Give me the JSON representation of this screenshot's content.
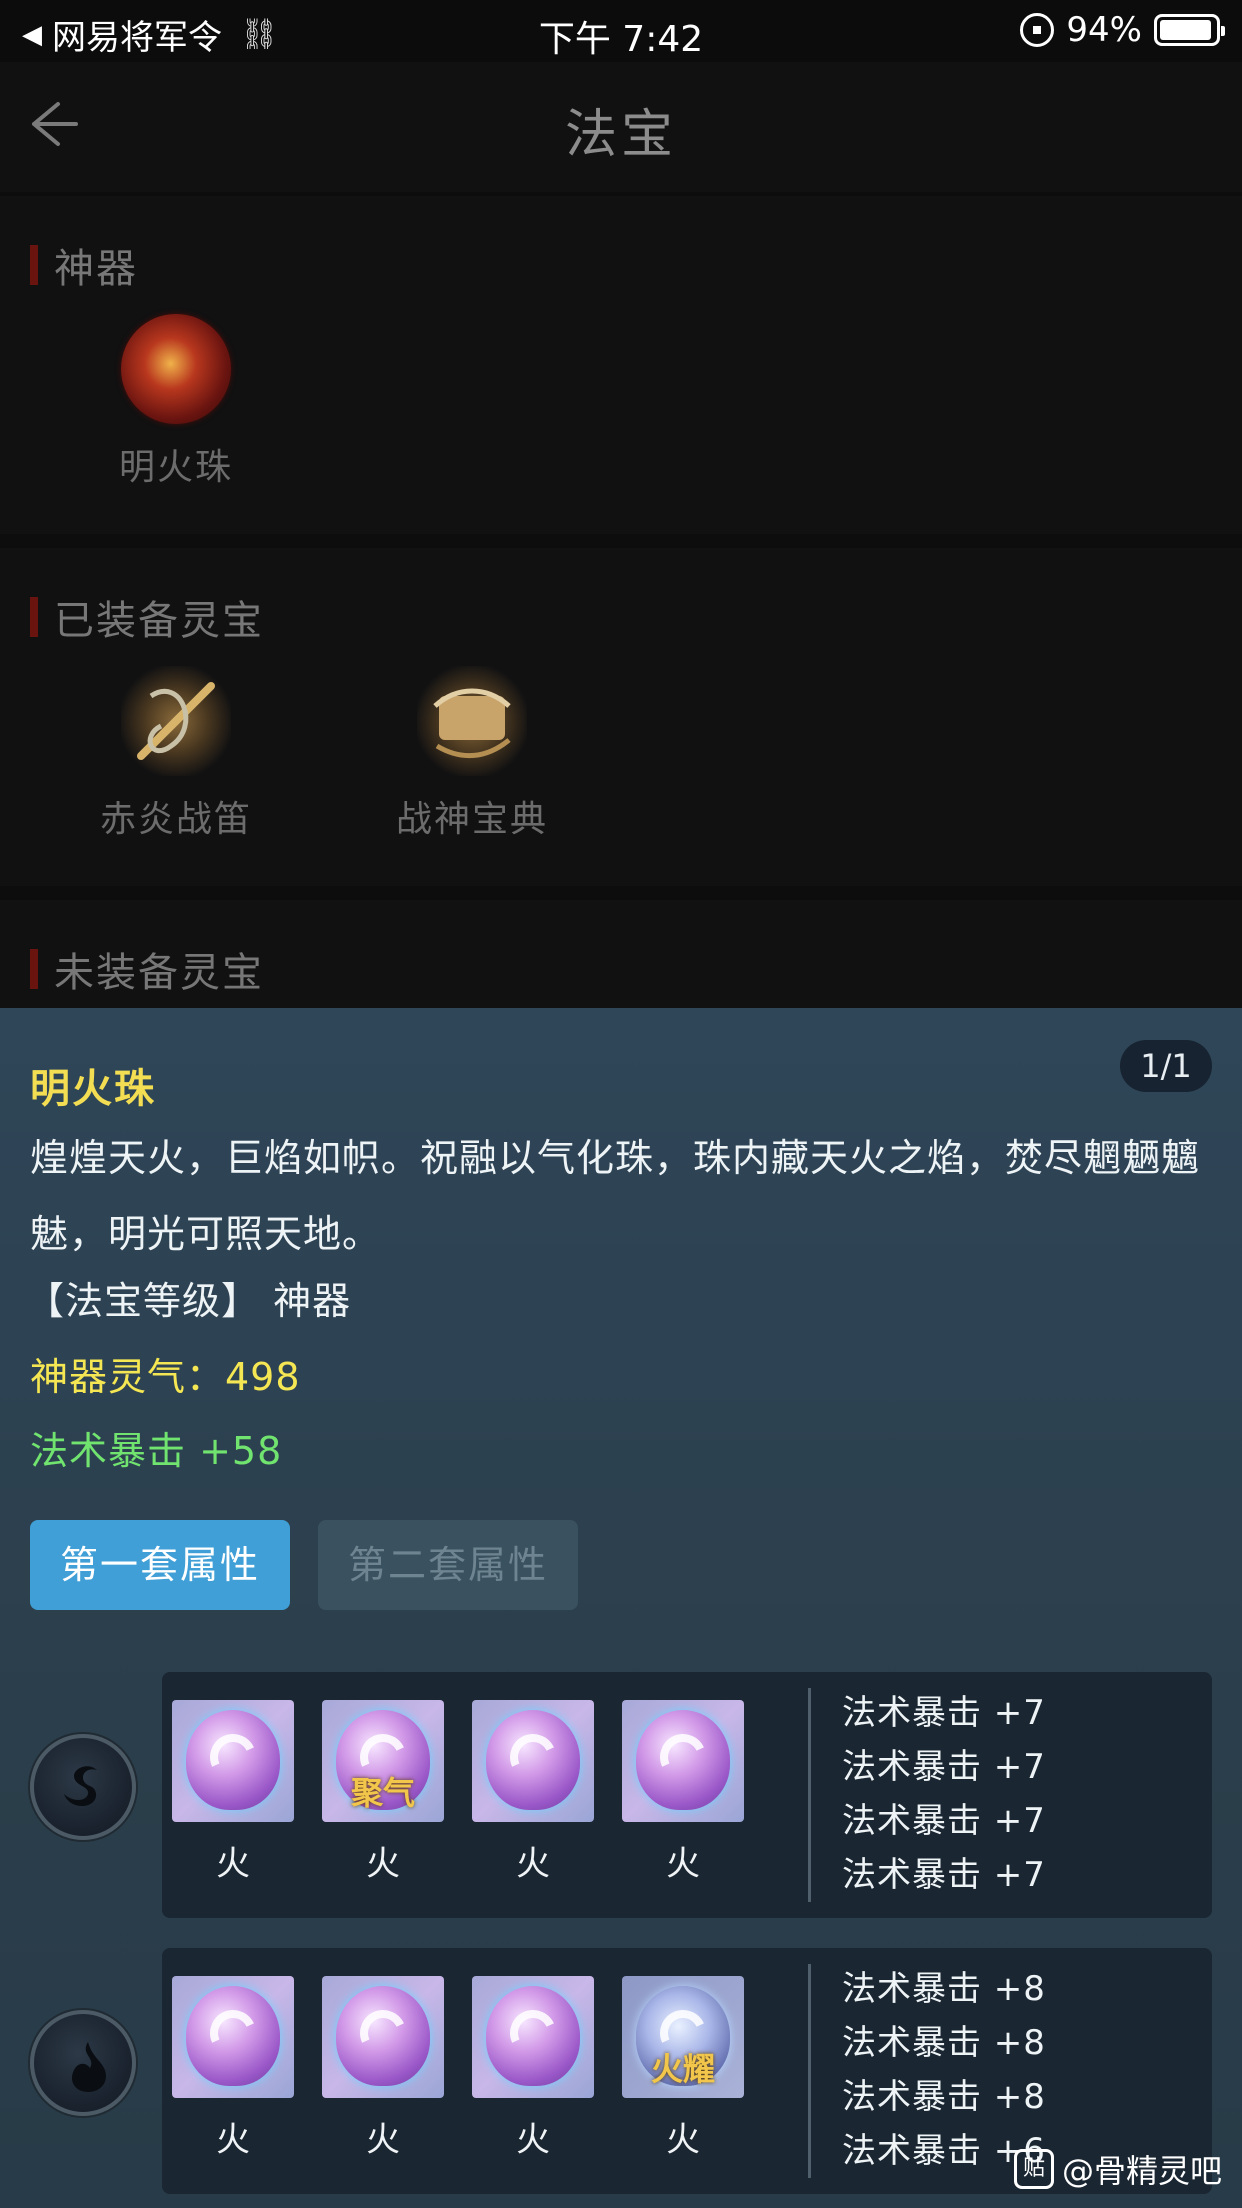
{
  "status_bar": {
    "back_app": "网易将军令",
    "time": "下午 7:42",
    "battery": "94%",
    "battery_level": 0.94
  },
  "nav": {
    "title": "法宝"
  },
  "sections": {
    "artifact": {
      "title": "神器",
      "items": [
        {
          "label": "明火珠",
          "icon": "fire-pearl-icon"
        }
      ]
    },
    "equipped": {
      "title": "已装备灵宝",
      "items": [
        {
          "label": "赤炎战笛",
          "icon": "flute-icon"
        },
        {
          "label": "战神宝典",
          "icon": "scroll-icon"
        }
      ]
    },
    "unequipped": {
      "title": "未装备灵宝"
    }
  },
  "panel": {
    "name": "明火珠",
    "page": "1/1",
    "description": "煌煌天火，巨焰如帜。祝融以气化珠，珠内藏天火之焰，焚尽魍魉魑魅，明光可照天地。",
    "level": "【法宝等级】 神器",
    "aura": "神器灵气：498",
    "crit": "法术暴击 +58",
    "tab_first": "第一套属性",
    "tab_second": "第二套属性",
    "rows": [
      {
        "gems": [
          {
            "label": "火",
            "tag": ""
          },
          {
            "label": "火",
            "tag": "聚气"
          },
          {
            "label": "火",
            "tag": ""
          },
          {
            "label": "火",
            "tag": ""
          }
        ],
        "stats": [
          "法术暴击 +7",
          "法术暴击 +7",
          "法术暴击 +7",
          "法术暴击 +7"
        ]
      },
      {
        "gems": [
          {
            "label": "火",
            "tag": ""
          },
          {
            "label": "火",
            "tag": ""
          },
          {
            "label": "火",
            "tag": ""
          },
          {
            "label": "火",
            "tag": "火耀"
          }
        ],
        "stats": [
          "法术暴击 +8",
          "法术暴击 +8",
          "法术暴击 +8",
          "法术暴击 +6"
        ]
      }
    ]
  },
  "watermark": "@骨精灵吧",
  "colors": {
    "accent_blue": "#3f9fd6",
    "title_yellow": "#f3dd52",
    "stat_green": "#71e36f",
    "section_red": "#6a1410"
  }
}
